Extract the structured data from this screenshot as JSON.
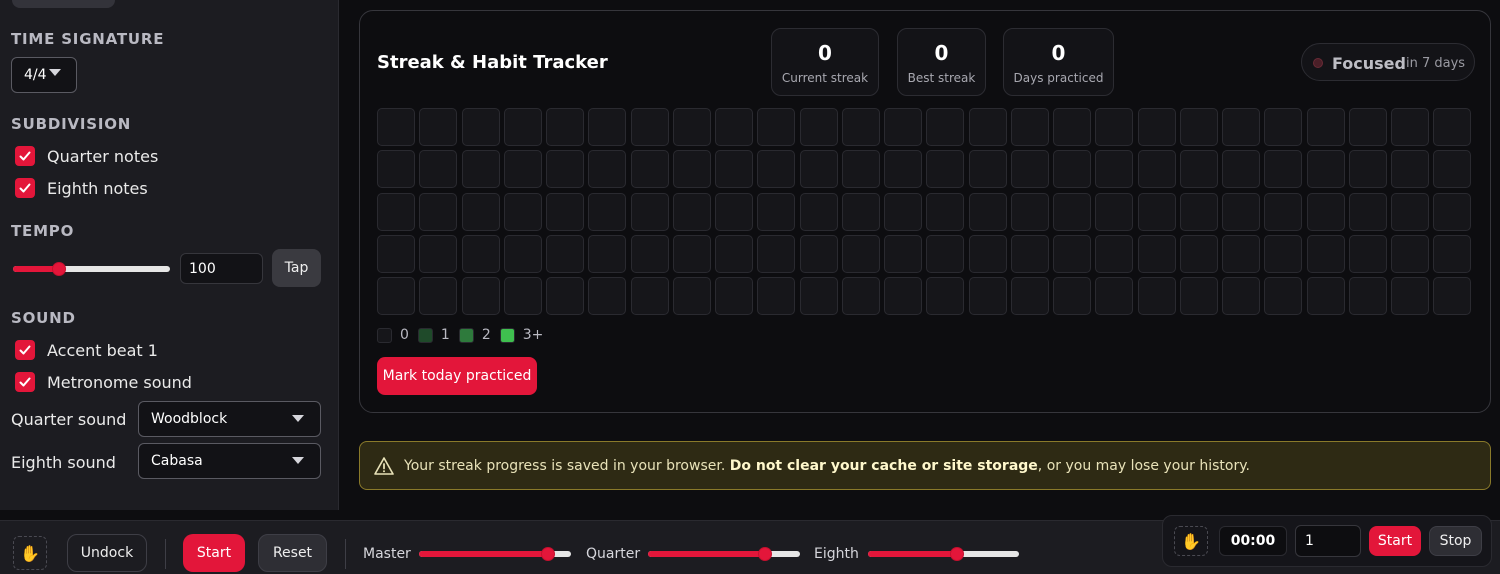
{
  "sidebar": {
    "time_signature": {
      "title": "TIME SIGNATURE",
      "value": "4/4"
    },
    "subdivision": {
      "title": "SUBDIVISION",
      "quarter_label": "Quarter notes",
      "eighth_label": "Eighth notes"
    },
    "tempo": {
      "title": "TEMPO",
      "value": "100",
      "tap_label": "Tap",
      "slider_fraction": 0.29
    },
    "sound": {
      "title": "SOUND",
      "accent_label": "Accent beat 1",
      "metronome_label": "Metronome sound",
      "quarter_sound_label": "Quarter sound",
      "quarter_sound_value": "Woodblock",
      "eighth_sound_label": "Eighth sound",
      "eighth_sound_value": "Cabasa"
    }
  },
  "tracker": {
    "title": "Streak & Habit Tracker",
    "stats": [
      {
        "value": "0",
        "label": "Current streak"
      },
      {
        "value": "0",
        "label": "Best streak"
      },
      {
        "value": "0",
        "label": "Days practiced"
      }
    ],
    "focus": {
      "label": "Focused",
      "sub": "in 7 days"
    },
    "legend": [
      {
        "label": "0",
        "color": "#16161a"
      },
      {
        "label": "1",
        "color": "#1f4a2a"
      },
      {
        "label": "2",
        "color": "#2e7a3c"
      },
      {
        "label": "3+",
        "color": "#3fbf4f"
      }
    ],
    "mark_button": "Mark today practiced"
  },
  "warning": {
    "prefix": "Your streak progress is saved in your browser.",
    "bold": "Do not clear your cache or site storage",
    "suffix": ", or you may lose your history."
  },
  "bottombar": {
    "undock_label": "Undock",
    "start_label": "Start",
    "reset_label": "Reset",
    "master_label": "Master",
    "master_fraction": 0.85,
    "quarter_label": "Quarter",
    "quarter_fraction": 0.77,
    "eighth_label": "Eighth",
    "eighth_fraction": 0.59
  },
  "timer": {
    "time": "00:00",
    "count": "1",
    "start_label": "Start",
    "stop_label": "Stop"
  },
  "colors": {
    "accent": "#e3163a",
    "warning_border": "#8a7a2a"
  }
}
